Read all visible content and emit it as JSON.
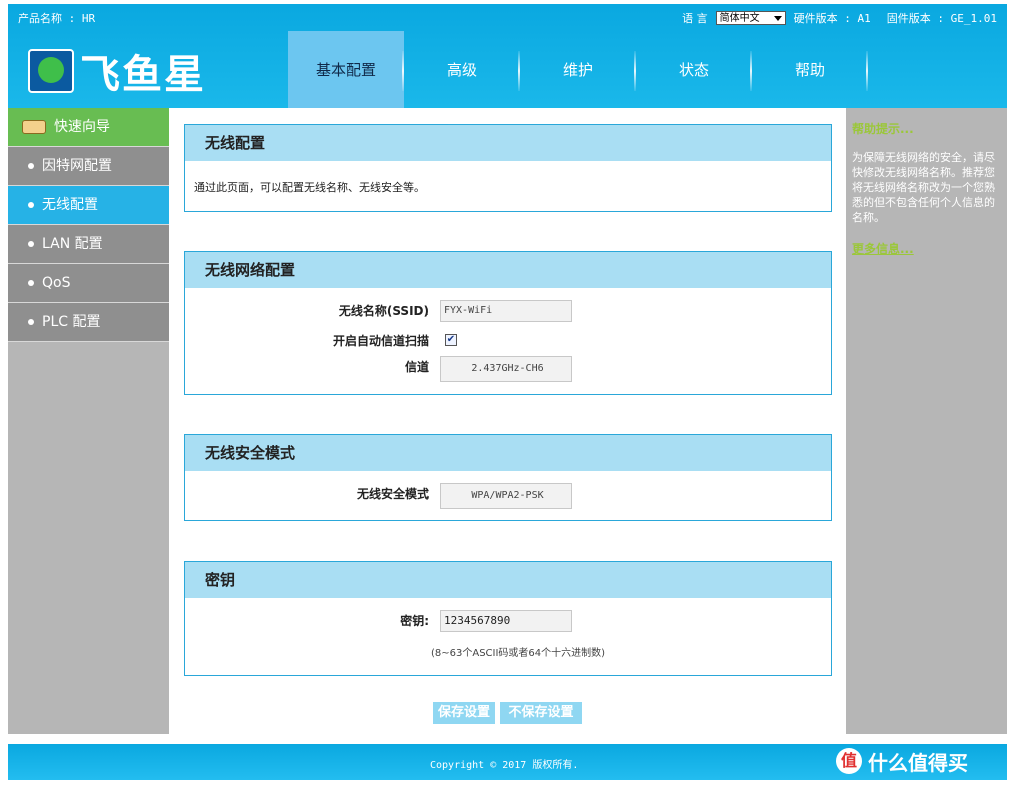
{
  "topbar": {
    "product_label": "产品名称 : HR",
    "lang_label": "语  言",
    "lang_value": "简体中文",
    "hw_version": "硬件版本 : A1",
    "fw_version": "固件版本 : GE_1.01"
  },
  "brand": {
    "logo_text": "飞鱼星"
  },
  "nav": {
    "tabs": [
      "基本配置",
      "高级",
      "维护",
      "状态",
      "帮助"
    ],
    "active_index": 0
  },
  "sidebar": {
    "quick_label": "快速向导",
    "items": [
      "因特网配置",
      "无线配置",
      "LAN 配置",
      "QoS",
      "PLC 配置"
    ],
    "active_index": 1
  },
  "panels": {
    "wireless": {
      "title": "无线配置",
      "description": "通过此页面，可以配置无线名称、无线安全等。"
    },
    "network": {
      "title": "无线网络配置",
      "ssid_label": "无线名称(SSID)",
      "ssid_value": "FYX-WiFi",
      "auto_scan_label": "开启自动信道扫描",
      "auto_scan_checked": true,
      "channel_label": "信道",
      "channel_value": "2.437GHz-CH6",
      "colon": ":"
    },
    "security": {
      "title": "无线安全模式",
      "mode_label": "无线安全模式",
      "mode_value": "WPA/WPA2-PSK",
      "colon": ":"
    },
    "key": {
      "title": "密钥",
      "key_label": "密钥:",
      "key_value": "1234567890",
      "hint": "(8~63个ASCII码或者64个十六进制数)"
    }
  },
  "buttons": {
    "save": "保存设置",
    "nosave": "不保存设置"
  },
  "help": {
    "title": "帮助提示...",
    "body": "为保障无线网络的安全，请尽快修改无线网络名称。推荐您将无线网络名称改为一个您熟悉的但不包含任何个人信息的名称。",
    "more": "更多信息..."
  },
  "footer": {
    "copyright": "Copyright © 2017 版权所有."
  },
  "watermark": {
    "badge": "值",
    "text": "什么值得买"
  }
}
